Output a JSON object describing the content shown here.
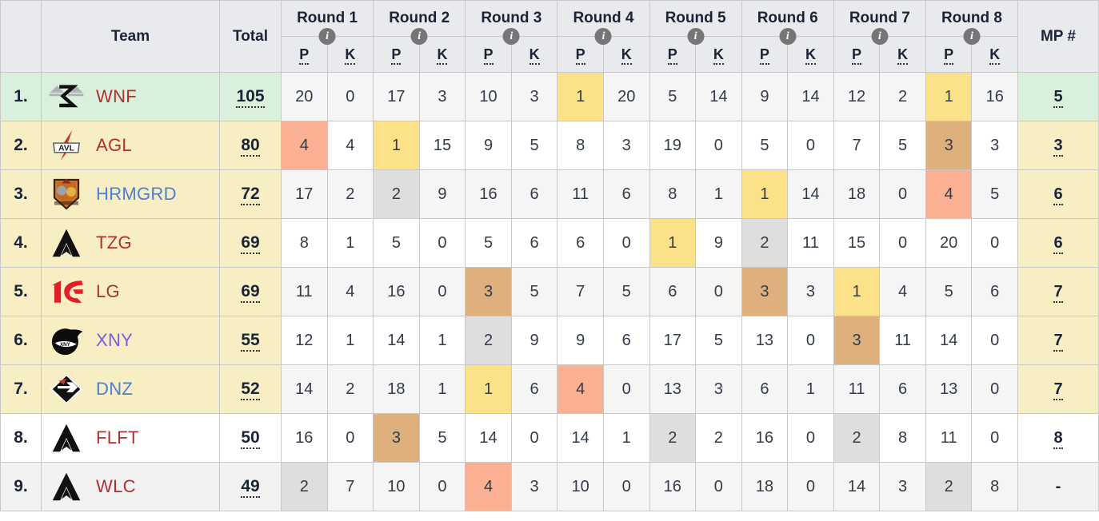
{
  "header": {
    "rank_label": "",
    "team_label": "Team",
    "total_label": "Total",
    "mp_label": "MP #",
    "p_label": "P",
    "k_label": "K",
    "info_icon": "info-icon",
    "rounds": [
      "Round 1",
      "Round 2",
      "Round 3",
      "Round 4",
      "Round 5",
      "Round 6",
      "Round 7",
      "Round 8"
    ]
  },
  "colors": {
    "header_bg": "#e8eaee",
    "row_green": "#d9f0dc",
    "row_cream": "#f7eec4",
    "row_white": "#ffffff",
    "row_grey": "#f2f2f2",
    "cell_band": "#f5f5f5",
    "highlight_salmon": "#fbb094",
    "highlight_yellow": "#fbe187",
    "highlight_grey": "#dedede",
    "highlight_tan": "#ddb07d",
    "team_red": "#b03030",
    "team_blue": "#4a7fd4",
    "team_purple": "#7b5ce0",
    "text_dark": "#1a2436"
  },
  "rows": [
    {
      "rank": "1.",
      "team": "WNF",
      "team_color": "#b03030",
      "logo": "scales-sigma-logo",
      "total": "105",
      "mp": "5",
      "row_tint": "tint-green",
      "band": "cell-odd",
      "cells": [
        {
          "v": "20",
          "hl": ""
        },
        {
          "v": "0",
          "hl": ""
        },
        {
          "v": "17",
          "hl": ""
        },
        {
          "v": "3",
          "hl": ""
        },
        {
          "v": "10",
          "hl": ""
        },
        {
          "v": "3",
          "hl": ""
        },
        {
          "v": "1",
          "hl": "hl-yellow"
        },
        {
          "v": "20",
          "hl": ""
        },
        {
          "v": "5",
          "hl": ""
        },
        {
          "v": "14",
          "hl": ""
        },
        {
          "v": "9",
          "hl": ""
        },
        {
          "v": "14",
          "hl": ""
        },
        {
          "v": "12",
          "hl": ""
        },
        {
          "v": "2",
          "hl": ""
        },
        {
          "v": "1",
          "hl": "hl-yellow"
        },
        {
          "v": "16",
          "hl": ""
        }
      ]
    },
    {
      "rank": "2.",
      "team": "AGL",
      "team_color": "#b03030",
      "logo": "avl-lightning-logo",
      "total": "80",
      "mp": "3",
      "row_tint": "tint-cream",
      "band": "cell-even",
      "cells": [
        {
          "v": "4",
          "hl": "hl-salmon"
        },
        {
          "v": "4",
          "hl": ""
        },
        {
          "v": "1",
          "hl": "hl-yellow"
        },
        {
          "v": "15",
          "hl": ""
        },
        {
          "v": "9",
          "hl": ""
        },
        {
          "v": "5",
          "hl": ""
        },
        {
          "v": "8",
          "hl": ""
        },
        {
          "v": "3",
          "hl": ""
        },
        {
          "v": "19",
          "hl": ""
        },
        {
          "v": "0",
          "hl": ""
        },
        {
          "v": "5",
          "hl": ""
        },
        {
          "v": "0",
          "hl": ""
        },
        {
          "v": "7",
          "hl": ""
        },
        {
          "v": "5",
          "hl": ""
        },
        {
          "v": "3",
          "hl": "hl-tan"
        },
        {
          "v": "3",
          "hl": ""
        }
      ]
    },
    {
      "rank": "3.",
      "team": "HRMGRD",
      "team_color": "#4a7fd4",
      "logo": "heroes-guard-crest-logo",
      "total": "72",
      "mp": "6",
      "row_tint": "tint-cream",
      "band": "cell-odd",
      "cells": [
        {
          "v": "17",
          "hl": ""
        },
        {
          "v": "2",
          "hl": ""
        },
        {
          "v": "2",
          "hl": "hl-grey"
        },
        {
          "v": "9",
          "hl": ""
        },
        {
          "v": "16",
          "hl": ""
        },
        {
          "v": "6",
          "hl": ""
        },
        {
          "v": "11",
          "hl": ""
        },
        {
          "v": "6",
          "hl": ""
        },
        {
          "v": "8",
          "hl": ""
        },
        {
          "v": "1",
          "hl": ""
        },
        {
          "v": "1",
          "hl": "hl-yellow"
        },
        {
          "v": "14",
          "hl": ""
        },
        {
          "v": "18",
          "hl": ""
        },
        {
          "v": "0",
          "hl": ""
        },
        {
          "v": "4",
          "hl": "hl-salmon"
        },
        {
          "v": "5",
          "hl": ""
        }
      ]
    },
    {
      "rank": "4.",
      "team": "TZG",
      "team_color": "#b03030",
      "logo": "apex-triangle-logo",
      "total": "69",
      "mp": "6",
      "row_tint": "tint-cream",
      "band": "cell-even",
      "cells": [
        {
          "v": "8",
          "hl": ""
        },
        {
          "v": "1",
          "hl": ""
        },
        {
          "v": "5",
          "hl": ""
        },
        {
          "v": "0",
          "hl": ""
        },
        {
          "v": "5",
          "hl": ""
        },
        {
          "v": "6",
          "hl": ""
        },
        {
          "v": "6",
          "hl": ""
        },
        {
          "v": "0",
          "hl": ""
        },
        {
          "v": "1",
          "hl": "hl-yellow"
        },
        {
          "v": "9",
          "hl": ""
        },
        {
          "v": "2",
          "hl": "hl-grey"
        },
        {
          "v": "11",
          "hl": ""
        },
        {
          "v": "15",
          "hl": ""
        },
        {
          "v": "0",
          "hl": ""
        },
        {
          "v": "20",
          "hl": ""
        },
        {
          "v": "0",
          "hl": ""
        }
      ]
    },
    {
      "rank": "5.",
      "team": "LG",
      "team_color": "#b03030",
      "logo": "lg-red-swoosh-logo",
      "total": "69",
      "mp": "7",
      "row_tint": "tint-cream",
      "band": "cell-odd",
      "cells": [
        {
          "v": "11",
          "hl": ""
        },
        {
          "v": "4",
          "hl": ""
        },
        {
          "v": "16",
          "hl": ""
        },
        {
          "v": "0",
          "hl": ""
        },
        {
          "v": "3",
          "hl": "hl-tan"
        },
        {
          "v": "5",
          "hl": ""
        },
        {
          "v": "7",
          "hl": ""
        },
        {
          "v": "5",
          "hl": ""
        },
        {
          "v": "6",
          "hl": ""
        },
        {
          "v": "0",
          "hl": ""
        },
        {
          "v": "3",
          "hl": "hl-tan"
        },
        {
          "v": "3",
          "hl": ""
        },
        {
          "v": "1",
          "hl": "hl-yellow"
        },
        {
          "v": "4",
          "hl": ""
        },
        {
          "v": "5",
          "hl": ""
        },
        {
          "v": "6",
          "hl": ""
        }
      ]
    },
    {
      "rank": "6.",
      "team": "XNY",
      "team_color": "#7b5ce0",
      "logo": "dragon-head-logo",
      "total": "55",
      "mp": "7",
      "row_tint": "tint-cream",
      "band": "cell-even",
      "cells": [
        {
          "v": "12",
          "hl": ""
        },
        {
          "v": "1",
          "hl": ""
        },
        {
          "v": "14",
          "hl": ""
        },
        {
          "v": "1",
          "hl": ""
        },
        {
          "v": "2",
          "hl": "hl-grey"
        },
        {
          "v": "9",
          "hl": ""
        },
        {
          "v": "9",
          "hl": ""
        },
        {
          "v": "6",
          "hl": ""
        },
        {
          "v": "17",
          "hl": ""
        },
        {
          "v": "5",
          "hl": ""
        },
        {
          "v": "13",
          "hl": ""
        },
        {
          "v": "0",
          "hl": ""
        },
        {
          "v": "3",
          "hl": "hl-tan"
        },
        {
          "v": "11",
          "hl": ""
        },
        {
          "v": "14",
          "hl": ""
        },
        {
          "v": "0",
          "hl": ""
        }
      ]
    },
    {
      "rank": "7.",
      "team": "DNZ",
      "team_color": "#4a7fd4",
      "logo": "dnz-arrow-diamond-logo",
      "total": "52",
      "mp": "7",
      "row_tint": "tint-cream",
      "band": "cell-odd",
      "cells": [
        {
          "v": "14",
          "hl": ""
        },
        {
          "v": "2",
          "hl": ""
        },
        {
          "v": "18",
          "hl": ""
        },
        {
          "v": "1",
          "hl": ""
        },
        {
          "v": "1",
          "hl": "hl-yellow"
        },
        {
          "v": "6",
          "hl": ""
        },
        {
          "v": "4",
          "hl": "hl-salmon"
        },
        {
          "v": "0",
          "hl": ""
        },
        {
          "v": "13",
          "hl": ""
        },
        {
          "v": "3",
          "hl": ""
        },
        {
          "v": "6",
          "hl": ""
        },
        {
          "v": "1",
          "hl": ""
        },
        {
          "v": "11",
          "hl": ""
        },
        {
          "v": "6",
          "hl": ""
        },
        {
          "v": "13",
          "hl": ""
        },
        {
          "v": "0",
          "hl": ""
        }
      ]
    },
    {
      "rank": "8.",
      "team": "FLFT",
      "team_color": "#b03030",
      "logo": "apex-triangle-logo",
      "total": "50",
      "mp": "8",
      "row_tint": "tint-white",
      "band": "cell-even",
      "cells": [
        {
          "v": "16",
          "hl": ""
        },
        {
          "v": "0",
          "hl": ""
        },
        {
          "v": "3",
          "hl": "hl-tan"
        },
        {
          "v": "5",
          "hl": ""
        },
        {
          "v": "14",
          "hl": ""
        },
        {
          "v": "0",
          "hl": ""
        },
        {
          "v": "14",
          "hl": ""
        },
        {
          "v": "1",
          "hl": ""
        },
        {
          "v": "2",
          "hl": "hl-grey"
        },
        {
          "v": "2",
          "hl": ""
        },
        {
          "v": "16",
          "hl": ""
        },
        {
          "v": "0",
          "hl": ""
        },
        {
          "v": "2",
          "hl": "hl-grey"
        },
        {
          "v": "8",
          "hl": ""
        },
        {
          "v": "11",
          "hl": ""
        },
        {
          "v": "0",
          "hl": ""
        }
      ]
    },
    {
      "rank": "9.",
      "team": "WLC",
      "team_color": "#b03030",
      "logo": "apex-triangle-logo",
      "total": "49",
      "mp": "-",
      "row_tint": "tint-grey",
      "band": "cell-odd",
      "cells": [
        {
          "v": "2",
          "hl": "hl-grey"
        },
        {
          "v": "7",
          "hl": ""
        },
        {
          "v": "10",
          "hl": ""
        },
        {
          "v": "0",
          "hl": ""
        },
        {
          "v": "4",
          "hl": "hl-salmon"
        },
        {
          "v": "3",
          "hl": ""
        },
        {
          "v": "10",
          "hl": ""
        },
        {
          "v": "0",
          "hl": ""
        },
        {
          "v": "16",
          "hl": ""
        },
        {
          "v": "0",
          "hl": ""
        },
        {
          "v": "18",
          "hl": ""
        },
        {
          "v": "0",
          "hl": ""
        },
        {
          "v": "14",
          "hl": ""
        },
        {
          "v": "3",
          "hl": ""
        },
        {
          "v": "2",
          "hl": "hl-grey"
        },
        {
          "v": "8",
          "hl": ""
        }
      ]
    }
  ]
}
